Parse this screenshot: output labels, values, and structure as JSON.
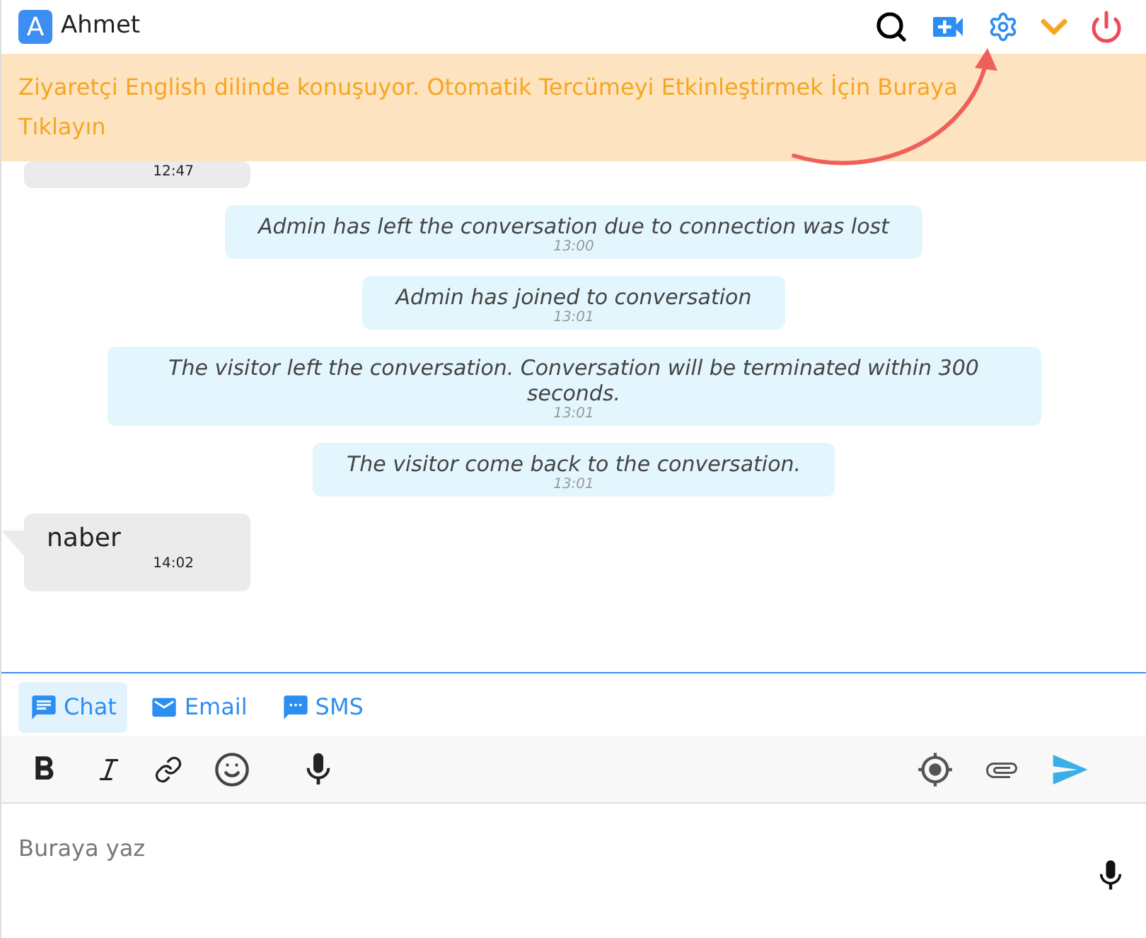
{
  "header": {
    "avatar_letter": "A",
    "name": "Ahmet"
  },
  "banner": {
    "text": "Ziyaretçi English dilinde konuşuyor. Otomatik Tercümeyi Etkinleştirmek İçin Buraya Tıklayın"
  },
  "messages": [
    {
      "kind": "visitor",
      "time": "12:47"
    },
    {
      "kind": "system",
      "text": "Admin has left the conversation due to connection was lost",
      "time": "13:00"
    },
    {
      "kind": "system",
      "text": "Admin has joined to conversation",
      "time": "13:01"
    },
    {
      "kind": "system",
      "text": "The visitor left the conversation. Conversation will be terminated within 300 seconds.",
      "time": "13:01"
    },
    {
      "kind": "system",
      "text": "The visitor come back to the conversation.",
      "time": "13:01"
    },
    {
      "kind": "visitor",
      "text": "naber",
      "time": "14:02"
    }
  ],
  "channels": [
    {
      "kind": "chat",
      "label": "Chat",
      "selected": true
    },
    {
      "kind": "email",
      "label": "Email",
      "selected": false
    },
    {
      "kind": "sms",
      "label": "SMS",
      "selected": false
    }
  ],
  "composer": {
    "placeholder": "Buraya yaz"
  }
}
